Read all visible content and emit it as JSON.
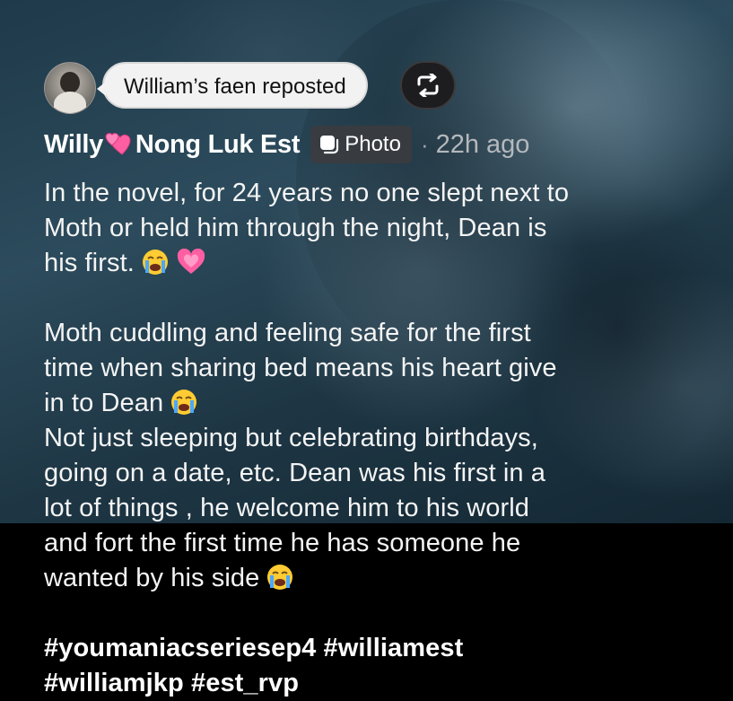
{
  "repost": {
    "label": "William’s faen reposted",
    "icon": "repost-icon"
  },
  "post": {
    "author_prefix": "Willy",
    "author_suffix": "Nong Luk Est",
    "author_emoji": "two-hearts-icon",
    "media_badge": "Photo",
    "separator": "·",
    "time": "22h ago",
    "lines_p1": [
      "In the novel, for 24 years no one slept next to",
      "Moth or held him through the night, Dean is",
      "his first."
    ],
    "lines_p2": [
      "Moth cuddling and feeling safe for the first",
      "time when sharing bed means his heart give",
      "in to Dean",
      "Not just sleeping but celebrating birthdays,",
      "going on a date, etc. Dean was his first in a",
      "lot of things , he welcome him to his world",
      "and fort the first time he has someone he",
      "wanted by his side"
    ],
    "hashtags": [
      "#youmaniacseriesep4 #williamest",
      "#williamjkp #est_rvp"
    ],
    "emojis": [
      "crying-face-icon",
      "growing-heart-icon"
    ]
  },
  "colors": {
    "text": "#f4f4f4",
    "time": "#b4b8bc",
    "bubble": "#f2f2f2",
    "badge": "#3c3c3e",
    "heart": "#ff5fa2",
    "emoji_face": "#ffcc33",
    "tears": "#4aa8ff"
  }
}
